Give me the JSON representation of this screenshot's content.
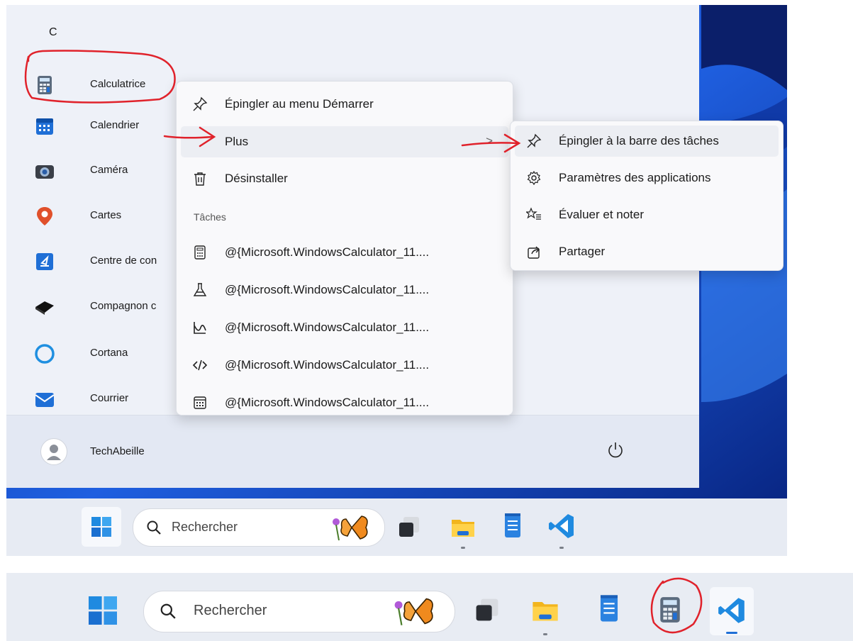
{
  "start_menu": {
    "section_letter": "C",
    "apps": [
      {
        "label": "Calculatrice",
        "icon": "calculator-icon"
      },
      {
        "label": "Calendrier",
        "icon": "calendar-icon"
      },
      {
        "label": "Caméra",
        "icon": "camera-icon"
      },
      {
        "label": "Cartes",
        "icon": "maps-icon"
      },
      {
        "label": "Centre de con",
        "icon": "feedback-icon"
      },
      {
        "label": "Compagnon c",
        "icon": "companion-icon"
      },
      {
        "label": "Cortana",
        "icon": "cortana-icon"
      },
      {
        "label": "Courrier",
        "icon": "mail-icon"
      }
    ],
    "user_name": "TechAbeille"
  },
  "context_menu": {
    "pin_start": "Épingler au menu Démarrer",
    "more": "Plus",
    "uninstall": "Désinstaller",
    "tasks_header": "Tâches",
    "tasks": [
      {
        "label": "@{Microsoft.WindowsCalculator_11....",
        "icon": "calculator-outline-icon"
      },
      {
        "label": "@{Microsoft.WindowsCalculator_11....",
        "icon": "flask-icon"
      },
      {
        "label": "@{Microsoft.WindowsCalculator_11....",
        "icon": "graph-icon"
      },
      {
        "label": "@{Microsoft.WindowsCalculator_11....",
        "icon": "code-icon"
      },
      {
        "label": "@{Microsoft.WindowsCalculator_11....",
        "icon": "calendar-outline-icon"
      }
    ]
  },
  "submenu": {
    "pin_taskbar": "Épingler à la barre des tâches",
    "app_settings": "Paramètres des applications",
    "rate_review": "Évaluer et noter",
    "share": "Partager"
  },
  "taskbar": {
    "search_placeholder": "Rechercher"
  },
  "colors": {
    "accent": "#1f6fd6",
    "annotation_red": "#e0222b",
    "menu_bg": "#f9f9fb",
    "start_bg": "#eef1f8"
  }
}
